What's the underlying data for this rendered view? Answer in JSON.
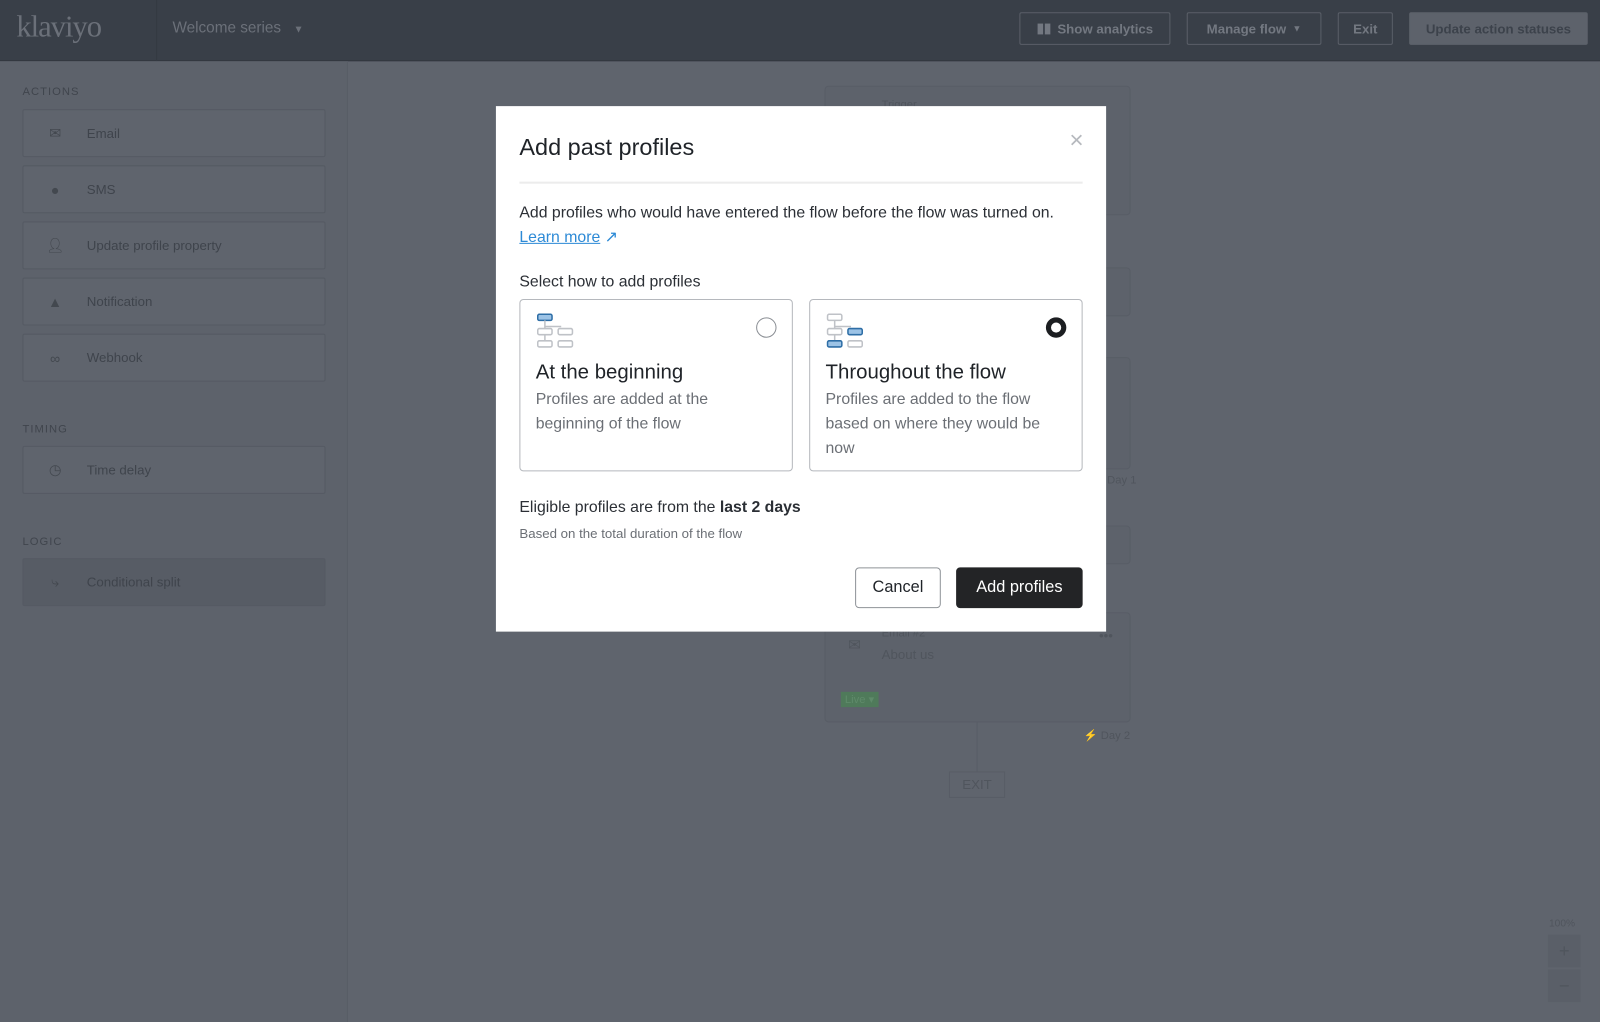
{
  "header": {
    "logo": "klaviyo",
    "flow_name": "Welcome series",
    "show_analytics": "Show analytics",
    "manage_flow": "Manage flow",
    "exit": "Exit",
    "update_statuses": "Update action statuses"
  },
  "sidebar": {
    "actions_label": "ACTIONS",
    "actions": [
      {
        "label": "Email",
        "icon": "envelope-icon"
      },
      {
        "label": "SMS",
        "icon": "chat-bubble-icon"
      },
      {
        "label": "Update profile property",
        "icon": "person-icon"
      },
      {
        "label": "Notification",
        "icon": "bell-icon"
      },
      {
        "label": "Webhook",
        "icon": "webhook-icon"
      }
    ],
    "timing_label": "TIMING",
    "timing": [
      {
        "label": "Time delay",
        "icon": "clock-icon"
      }
    ],
    "logic_label": "LOGIC",
    "logic": [
      {
        "label": "Conditional split",
        "icon": "split-icon"
      }
    ]
  },
  "canvas": {
    "trigger": "Trigger",
    "day1": "Day 1",
    "email2_name": "Email #2",
    "email2_subject": "About us",
    "status": "Live ▾",
    "day2": "Day 2",
    "exit": "EXIT",
    "zoom": "100%",
    "zoom_in": "+",
    "zoom_out": "−"
  },
  "modal": {
    "title": "Add past profiles",
    "close": "×",
    "description": "Add profiles who would have entered the flow before the flow was turned on.",
    "learn_more": "Learn more",
    "select_label": "Select how to add profiles",
    "options": [
      {
        "title": "At the beginning",
        "description": "Profiles are added at the beginning of the flow",
        "selected": false
      },
      {
        "title": "Throughout the flow",
        "description": "Profiles are added to the flow based on where they would be now",
        "selected": true
      }
    ],
    "eligible_prefix": "Eligible profiles are from the",
    "eligible_value": "last 2 days",
    "basis": "Based on the total duration of the flow",
    "cancel": "Cancel",
    "add": "Add profiles"
  },
  "colors": {
    "accent": "#2d8ad6",
    "primary_button": "#232426",
    "icon_blue": "#4a90c8"
  }
}
